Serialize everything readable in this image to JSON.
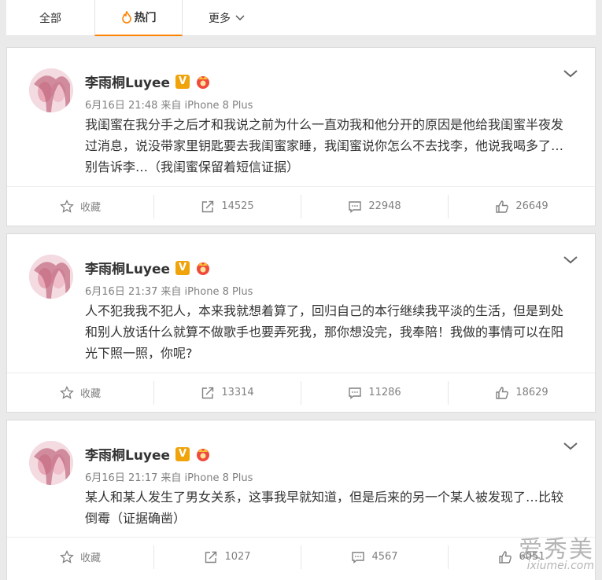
{
  "tabs": [
    {
      "label": "全部"
    },
    {
      "label": "热门",
      "icon": "flame-icon",
      "active": true
    },
    {
      "label": "更多",
      "icon": "chevron-down-icon"
    }
  ],
  "posts": [
    {
      "user": "李雨桐Luyee",
      "verified_label": "V",
      "time": "6月16日 21:48",
      "source": "来自 iPhone 8 Plus",
      "text": "我闺蜜在我分手之后才和我说之前为什么一直劝我和他分开的原因是他给我闺蜜半夜发过消息，说没带家里钥匙要去我闺蜜家睡，我闺蜜说你怎么不去找李，他说我喝多了…别告诉李…（我闺蜜保留着短信证据）",
      "actions": {
        "fav": "收藏",
        "repost": "14525",
        "comment": "22948",
        "like": "26649"
      }
    },
    {
      "user": "李雨桐Luyee",
      "verified_label": "V",
      "time": "6月16日 21:37",
      "source": "来自 iPhone 8 Plus",
      "text": "人不犯我我不犯人，本来我就想着算了，回归自己的本行继续我平淡的生活，但是到处和别人放话什么就算不做歌手也要弄死我，那你想没完，我奉陪！我做的事情可以在阳光下照一照，你呢?",
      "actions": {
        "fav": "收藏",
        "repost": "13314",
        "comment": "11286",
        "like": "18629"
      }
    },
    {
      "user": "李雨桐Luyee",
      "verified_label": "V",
      "time": "6月16日 21:17",
      "source": "来自 iPhone 8 Plus",
      "text": "某人和某人发生了男女关系，这事我早就知道，但是后来的另一个某人被发现了…比较倒霉（证据确凿）",
      "actions": {
        "fav": "收藏",
        "repost": "1027",
        "comment": "4567",
        "like": "6051"
      }
    }
  ],
  "watermark": {
    "line1": "爱秀美",
    "line2": "ixiumei.com"
  },
  "colors": {
    "accent": "#ff8200",
    "verified": "#f0a30a",
    "meta": "#808080"
  }
}
